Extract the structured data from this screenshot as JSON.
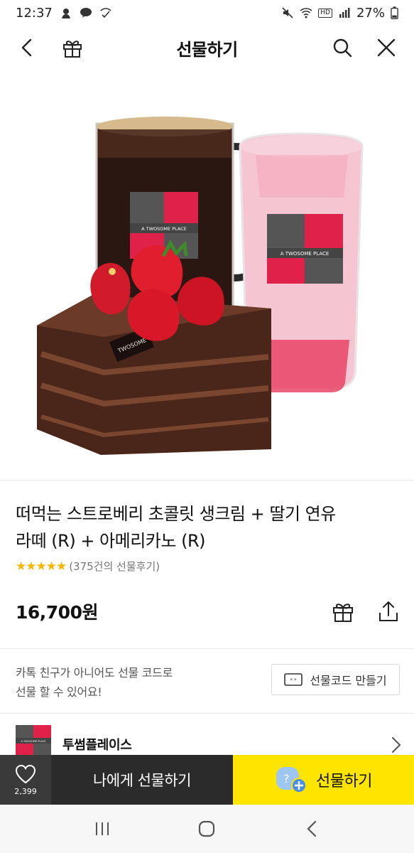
{
  "status_bar": {
    "time": "12:37",
    "battery": "27%",
    "hd_label": "HD",
    "icons": [
      "kakao-icon",
      "chat-icon",
      "wifi-call-icon",
      "mute-icon",
      "wifi-icon",
      "hd-voice-icon",
      "signal-icon"
    ]
  },
  "header": {
    "title": "선물하기",
    "icons": [
      "back-icon",
      "gift-box-icon",
      "search-icon",
      "close-icon"
    ]
  },
  "product": {
    "image_texts": {
      "brand_a": "A TWOSOME PLACE",
      "brand_b": "A TWOSOME PLACE",
      "chocolate_tag": "TWOSOME"
    },
    "name_line1": "떠먹는 스트로베리 초콜릿 생크림 + 딸기 연유",
    "name_line2": "라떼 (R) + 아메리카노 (R)",
    "stars": "★★★★★",
    "rating": 5,
    "review_text": "(375건의 선물후기)",
    "price": "16,700원"
  },
  "gift_code": {
    "desc_line1": "카톡 친구가 아니어도 선물 코드로",
    "desc_line2": "선물 할 수 있어요!",
    "button_label": "선물코드 만들기"
  },
  "brand": {
    "logo_text": "A TWOSOME PLACE",
    "name": "투썸플레이스"
  },
  "buy_bar": {
    "like_count": "2,399",
    "self_gift_label": "나에게 선물하기",
    "gift_label": "선물하기"
  },
  "colors": {
    "accent_yellow": "#FEE500",
    "dark_bar": "#2B2B2B",
    "star": "#F5B700",
    "twosome_red": "#E0224A"
  }
}
